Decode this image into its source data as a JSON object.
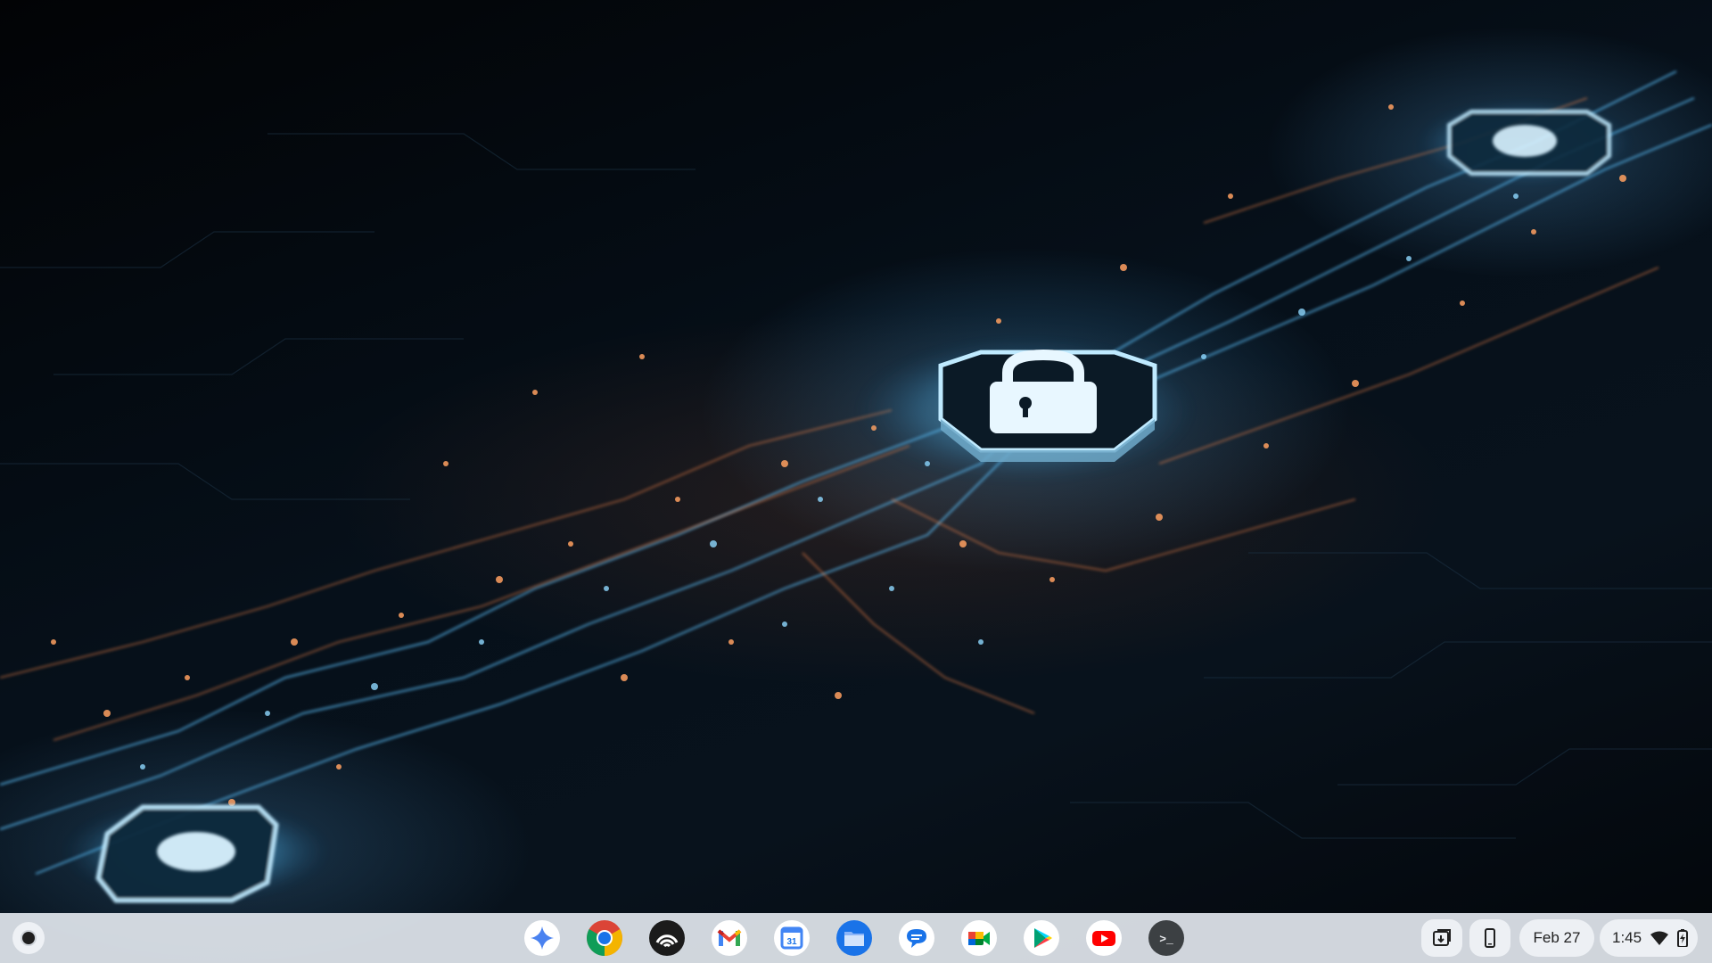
{
  "shelf": {
    "apps": [
      {
        "name": "gemini-app-icon"
      },
      {
        "name": "chrome-app-icon"
      },
      {
        "name": "podcast-app-icon"
      },
      {
        "name": "gmail-app-icon"
      },
      {
        "name": "calendar-app-icon",
        "label": "31"
      },
      {
        "name": "files-app-icon"
      },
      {
        "name": "chat-app-icon"
      },
      {
        "name": "meet-app-icon"
      },
      {
        "name": "play-store-app-icon"
      },
      {
        "name": "youtube-app-icon"
      },
      {
        "name": "terminal-app-icon",
        "label": ">_"
      }
    ],
    "tray": {
      "date": "Feb 27",
      "time": "1:45"
    }
  },
  "colors": {
    "shelf_bg": "#e2e7ee",
    "accent_blue": "#1a73e8",
    "wallpaper_glow_blue": "#5fc4ff",
    "wallpaper_glow_orange": "#ff8a4c"
  }
}
